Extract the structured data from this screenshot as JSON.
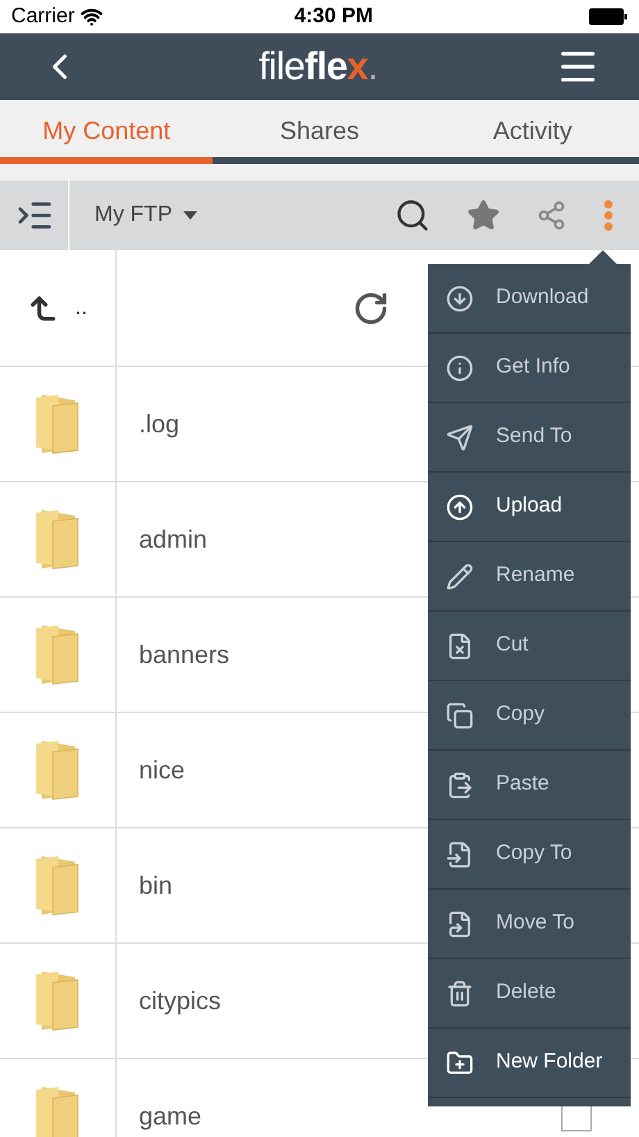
{
  "status_bar": {
    "carrier": "Carrier",
    "time": "4:30 PM"
  },
  "header": {
    "logo": {
      "light": "file",
      "bold": "fle",
      "accent": "x",
      "dot": "."
    }
  },
  "tabs": [
    {
      "label": "My Content",
      "selected": true
    },
    {
      "label": "Shares",
      "selected": false
    },
    {
      "label": "Activity",
      "selected": false
    }
  ],
  "toolbar": {
    "location": "My FTP"
  },
  "parent_row": {
    "label": ".."
  },
  "folders": [
    {
      "name": ".log"
    },
    {
      "name": "admin"
    },
    {
      "name": "banners"
    },
    {
      "name": "nice"
    },
    {
      "name": "bin"
    },
    {
      "name": "citypics"
    },
    {
      "name": "game",
      "checked": false
    }
  ],
  "menu": [
    {
      "label": "Download",
      "highlighted": false
    },
    {
      "label": "Get Info",
      "highlighted": false
    },
    {
      "label": "Send To",
      "highlighted": false
    },
    {
      "label": "Upload",
      "highlighted": true
    },
    {
      "label": "Rename",
      "highlighted": false
    },
    {
      "label": "Cut",
      "highlighted": false
    },
    {
      "label": "Copy",
      "highlighted": false
    },
    {
      "label": "Paste",
      "highlighted": false
    },
    {
      "label": "Copy To",
      "highlighted": false
    },
    {
      "label": "Move To",
      "highlighted": false
    },
    {
      "label": "Delete",
      "highlighted": false
    },
    {
      "label": "New Folder",
      "highlighted": true
    }
  ]
}
